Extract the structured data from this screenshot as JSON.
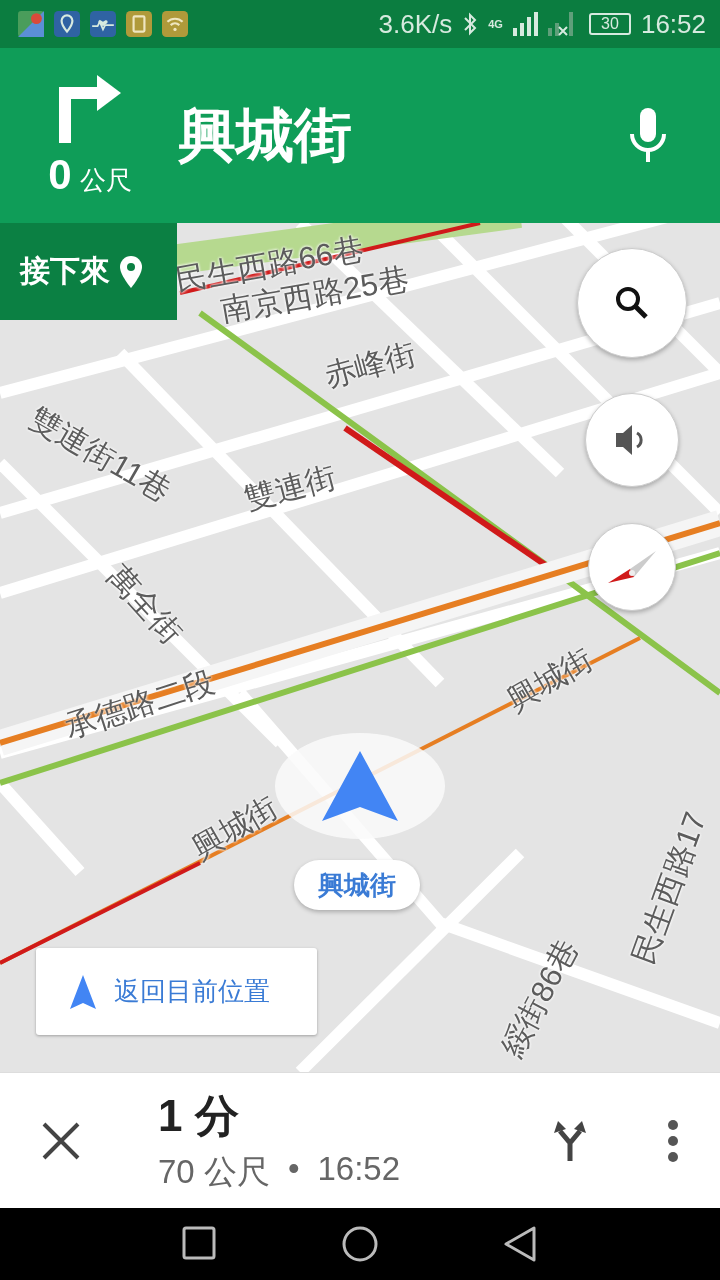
{
  "status_bar": {
    "speed": "3.6K/s",
    "network": "4G",
    "battery": "30",
    "time": "16:52"
  },
  "header": {
    "distance": "0",
    "unit": "公尺",
    "street": "興城街"
  },
  "next_button": {
    "label": "接下來"
  },
  "map": {
    "labels": [
      {
        "text": "民生西路66巷"
      },
      {
        "text": "南京西路25巷"
      },
      {
        "text": "赤峰街"
      },
      {
        "text": "雙連街11巷"
      },
      {
        "text": "雙連街"
      },
      {
        "text": "萬全街"
      },
      {
        "text": "承德路二段"
      },
      {
        "text": "興城街"
      },
      {
        "text": "興城街"
      },
      {
        "text": "綏街86巷"
      },
      {
        "text": "民生西路17"
      }
    ],
    "current_street": "興城街",
    "recenter": "返回目前位置"
  },
  "trip": {
    "duration": "1 分",
    "distance": "70 公尺",
    "separator": "•",
    "arrival": "16:52"
  }
}
